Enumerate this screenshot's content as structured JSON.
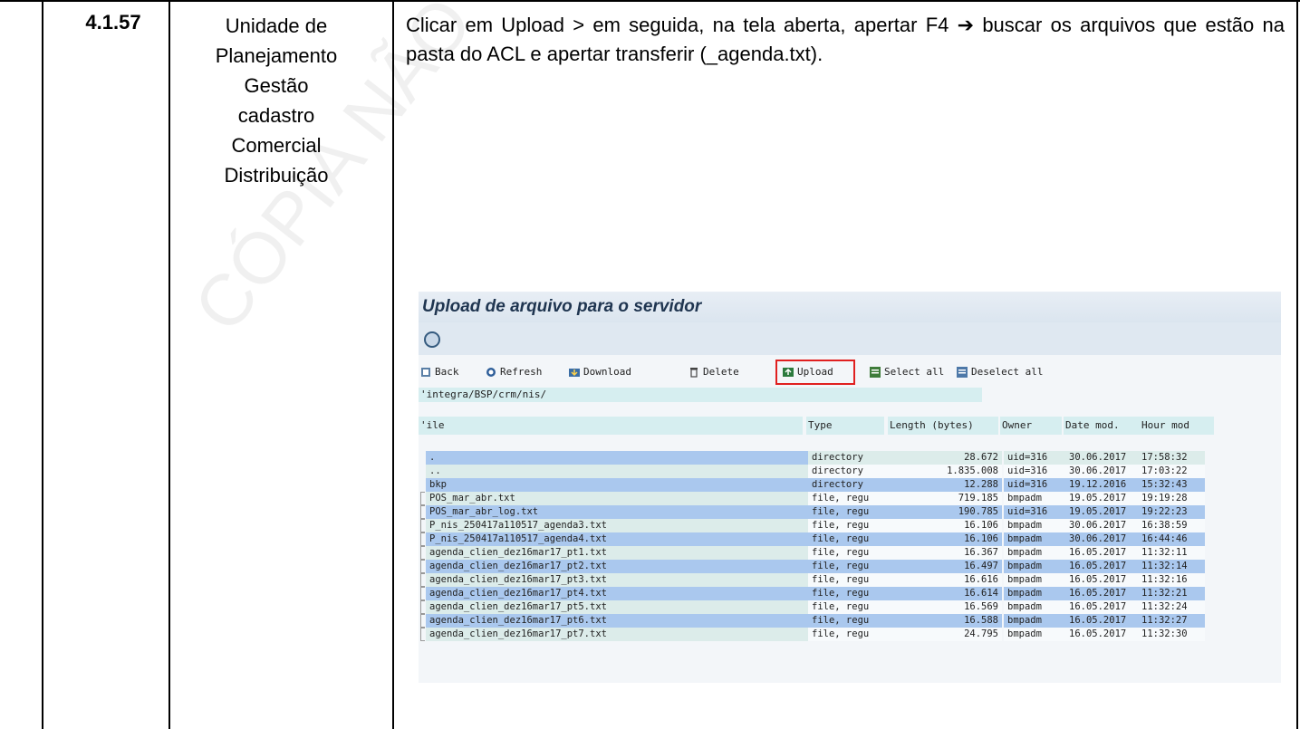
{
  "row": {
    "step": "4.1.57",
    "unit_lines": [
      "Unidade de",
      "Planejamento",
      "Gestão",
      "cadastro",
      "Comercial",
      "Distribuição"
    ],
    "instruction": "Clicar em Upload > em seguida, na tela aberta, apertar F4 ➔ buscar os arquivos que estão na pasta do ACL e apertar transferir (_agenda.txt)."
  },
  "watermark": "CÓPIA NÃO CONTROLADA",
  "sap": {
    "title": "Upload de arquivo para o servidor",
    "toolbar": {
      "back": "Back",
      "refresh": "Refresh",
      "download": "Download",
      "delete": "Delete",
      "upload": "Upload",
      "select_all": "Select all",
      "deselect_all": "Deselect all"
    },
    "path": "'integra/BSP/crm/nis/",
    "columns": {
      "file": "'ile",
      "type": "Type",
      "length": "Length (bytes)",
      "owner": "Owner",
      "date": "Date mod.",
      "hour": "Hour mod"
    },
    "files": [
      {
        "name": ".",
        "type": "directory",
        "length": "28.672",
        "owner": "uid=316",
        "date": "30.06.2017",
        "hour": "17:58:32"
      },
      {
        "name": "..",
        "type": "directory",
        "length": "1.835.008",
        "owner": "uid=316",
        "date": "30.06.2017",
        "hour": "17:03:22"
      },
      {
        "name": "bkp",
        "type": "directory",
        "length": "12.288",
        "owner": "uid=316",
        "date": "19.12.2016",
        "hour": "15:32:43"
      },
      {
        "name": "POS_mar_abr.txt",
        "type": "file, regu",
        "length": "719.185",
        "owner": "bmpadm",
        "date": "19.05.2017",
        "hour": "19:19:28"
      },
      {
        "name": "POS_mar_abr_log.txt",
        "type": "file, regu",
        "length": "190.785",
        "owner": "uid=316",
        "date": "19.05.2017",
        "hour": "19:22:23"
      },
      {
        "name": "P_nis_250417a110517_agenda3.txt",
        "type": "file, regu",
        "length": "16.106",
        "owner": "bmpadm",
        "date": "30.06.2017",
        "hour": "16:38:59"
      },
      {
        "name": "P_nis_250417a110517_agenda4.txt",
        "type": "file, regu",
        "length": "16.106",
        "owner": "bmpadm",
        "date": "30.06.2017",
        "hour": "16:44:46"
      },
      {
        "name": "agenda_clien_dez16mar17_pt1.txt",
        "type": "file, regu",
        "length": "16.367",
        "owner": "bmpadm",
        "date": "16.05.2017",
        "hour": "11:32:11"
      },
      {
        "name": "agenda_clien_dez16mar17_pt2.txt",
        "type": "file, regu",
        "length": "16.497",
        "owner": "bmpadm",
        "date": "16.05.2017",
        "hour": "11:32:14"
      },
      {
        "name": "agenda_clien_dez16mar17_pt3.txt",
        "type": "file, regu",
        "length": "16.616",
        "owner": "bmpadm",
        "date": "16.05.2017",
        "hour": "11:32:16"
      },
      {
        "name": "agenda_clien_dez16mar17_pt4.txt",
        "type": "file, regu",
        "length": "16.614",
        "owner": "bmpadm",
        "date": "16.05.2017",
        "hour": "11:32:21"
      },
      {
        "name": "agenda_clien_dez16mar17_pt5.txt",
        "type": "file, regu",
        "length": "16.569",
        "owner": "bmpadm",
        "date": "16.05.2017",
        "hour": "11:32:24"
      },
      {
        "name": "agenda_clien_dez16mar17_pt6.txt",
        "type": "file, regu",
        "length": "16.588",
        "owner": "bmpadm",
        "date": "16.05.2017",
        "hour": "11:32:27"
      },
      {
        "name": "agenda_clien_dez16mar17_pt7.txt",
        "type": "file, regu",
        "length": "24.795",
        "owner": "bmpadm",
        "date": "16.05.2017",
        "hour": "11:32:30"
      }
    ],
    "highlight_color": "#e02020"
  }
}
